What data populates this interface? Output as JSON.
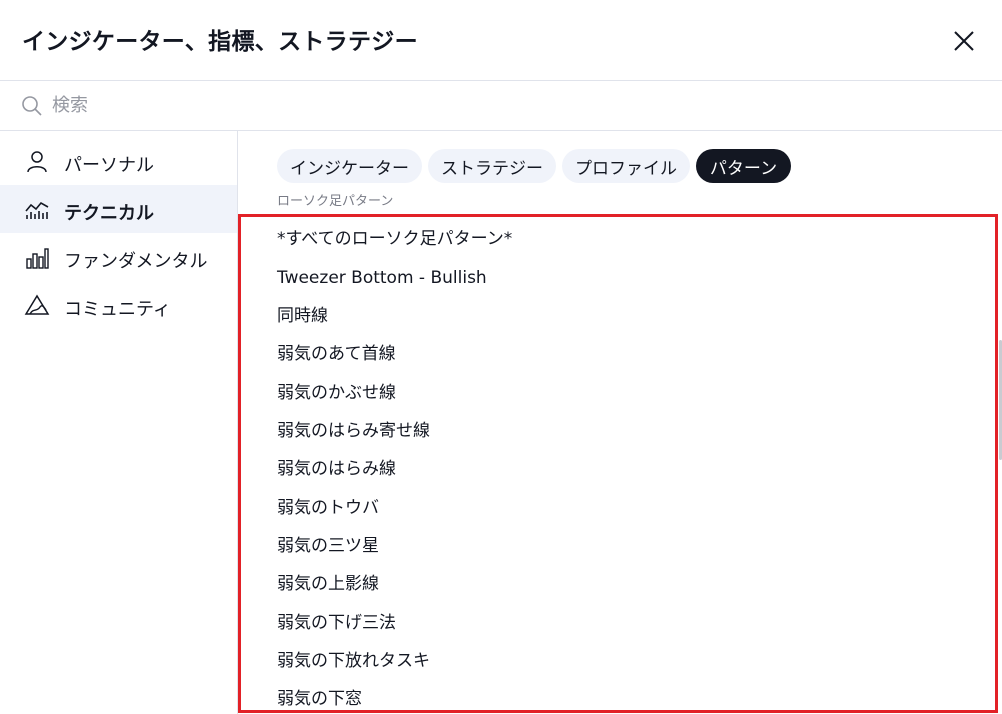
{
  "header": {
    "title": "インジケーター、指標、ストラテジー"
  },
  "search": {
    "placeholder": "検索",
    "value": ""
  },
  "sidebar": {
    "items": [
      {
        "label": "パーソナル",
        "icon": "user-icon",
        "active": false
      },
      {
        "label": "テクニカル",
        "icon": "technical-chart-icon",
        "active": true
      },
      {
        "label": "ファンダメンタル",
        "icon": "bar-chart-icon",
        "active": false
      },
      {
        "label": "コミュニティ",
        "icon": "community-icon",
        "active": false
      }
    ]
  },
  "tabs": [
    {
      "label": "インジケーター",
      "active": false
    },
    {
      "label": "ストラテジー",
      "active": false
    },
    {
      "label": "プロファイル",
      "active": false
    },
    {
      "label": "パターン",
      "active": true
    }
  ],
  "section": {
    "label": "ローソク足パターン"
  },
  "patterns": [
    "*すべてのローソク足パターン*",
    "Tweezer Bottom - Bullish",
    "同時線",
    "弱気のあて首線",
    "弱気のかぶせ線",
    "弱気のはらみ寄せ線",
    "弱気のはらみ線",
    "弱気のトウバ",
    "弱気の三ツ星",
    "弱気の上影線",
    "弱気の下げ三法",
    "弱気の下放れタスキ",
    "弱気の下窓"
  ],
  "colors": {
    "highlight_border": "#e22127",
    "active_chip_bg": "#131722",
    "chip_bg": "#f0f3fa",
    "text": "#131722"
  }
}
